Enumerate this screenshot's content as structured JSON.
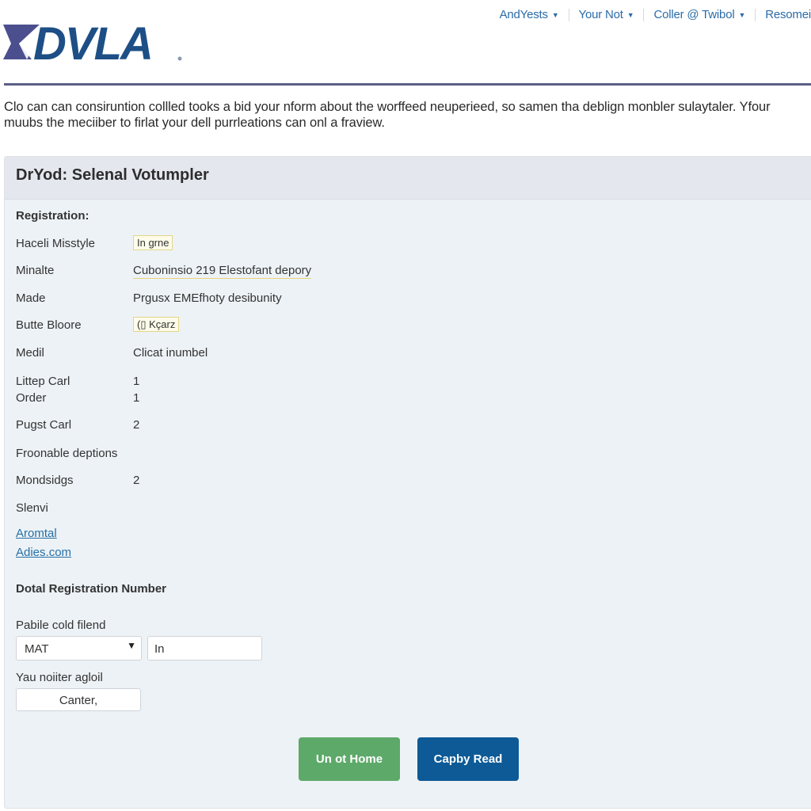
{
  "topnav": {
    "items": [
      {
        "label": "AndYests",
        "caret": "▼"
      },
      {
        "label": "Your Not",
        "caret": "▼"
      },
      {
        "label": "Coller @ Twibol",
        "caret": "▼"
      },
      {
        "label": "Resomei"
      }
    ]
  },
  "logo": {
    "text": "DVLA"
  },
  "intro": {
    "line1": "Clo can can consiruntion collled tooks a bid your nform about the worffeed neuperieed, so samen tha deblign monbler sulaytaler. Yfour",
    "line2": "muubs the meciiber to firlat your dell purrleations can onl a fraview."
  },
  "panel": {
    "title": "DrYod: Selenal Votumpler",
    "section_registration": "Registration:",
    "rows": [
      {
        "label": "Haceli Misstyle",
        "value": "In grne"
      },
      {
        "label": "Minalte",
        "value": "Cuboninsio 219 Elestofant depory"
      },
      {
        "label": "Made",
        "value": "Prgusx EMEfhoty desibunity"
      },
      {
        "label": "Butte Bloore",
        "value": "(▯ Kçarz"
      },
      {
        "label": "Medil",
        "value": "Clicat inumbel"
      },
      {
        "label": "Littep Carl",
        "value": "1"
      },
      {
        "label": "Order",
        "value": "1"
      },
      {
        "label": "Pugst Carl",
        "value": "2"
      },
      {
        "label": "Froonable deptions",
        "value": ""
      },
      {
        "label": "Mondsidgs",
        "value": "2"
      },
      {
        "label": "Slenvi",
        "value": ""
      }
    ],
    "links": [
      "Aromtal",
      "Adies.com"
    ],
    "section_number": "Dotal Registration Number",
    "field1_label": "Pabile cold filend",
    "select_value": "MAT",
    "select_arrow": "▼",
    "input_value": "In",
    "field2_label": "Yau noiiter agloil",
    "input2_value": "Canter,",
    "button_green": "Un ot Home",
    "button_blue": "Capby Read"
  },
  "colors": {
    "nav_link": "#2b6ca8",
    "logo_blue": "#1d4f86",
    "logo_purple": "#4b4f8e",
    "green_button": "#5da969",
    "blue_button": "#0d5a96"
  }
}
